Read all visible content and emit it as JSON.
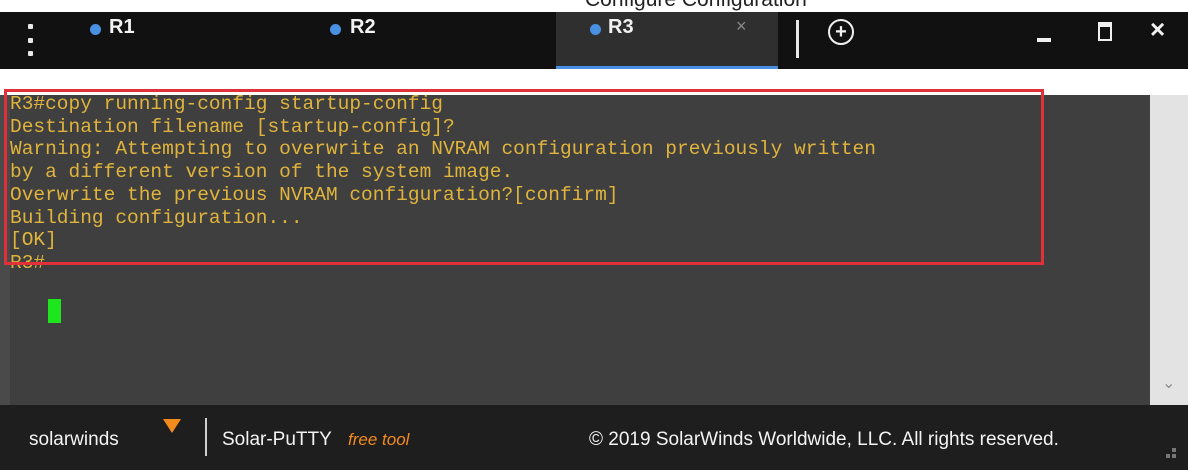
{
  "caption": {
    "text": "Configure Configuration"
  },
  "tabs": [
    {
      "label": "R1",
      "active": false,
      "dot_color": "#4a90e2"
    },
    {
      "label": "R2",
      "active": false,
      "dot_color": "#4a90e2"
    },
    {
      "label": "R3",
      "active": true,
      "dot_color": "#4a90e2",
      "close_glyph": "×"
    }
  ],
  "titlebar": {
    "add_glyph": "+",
    "close_glyph": "×",
    "icons": [
      "menu-dots-icon",
      "add-tab-icon",
      "minimize-icon",
      "maximize-icon",
      "close-icon"
    ]
  },
  "terminal": {
    "text_color": "#e0b43c",
    "lines": [
      "R3#copy running-config startup-config",
      "Destination filename [startup-config]?",
      "Warning: Attempting to overwrite an NVRAM configuration previously written",
      "by a different version of the system image.",
      "Overwrite the previous NVRAM configuration?[confirm]",
      "Building configuration...",
      "[OK]",
      "R3#"
    ],
    "highlight_color": "#e0313b",
    "cursor_color": "#1ee61e"
  },
  "scrollbar": {
    "down_glyph": "⌄"
  },
  "footer": {
    "brand": "solarwinds",
    "product": "Solar-PuTTY",
    "badge": "free tool",
    "copyright": "© 2019 SolarWinds Worldwide, LLC. All rights reserved.",
    "accent": "#f28b1c"
  }
}
